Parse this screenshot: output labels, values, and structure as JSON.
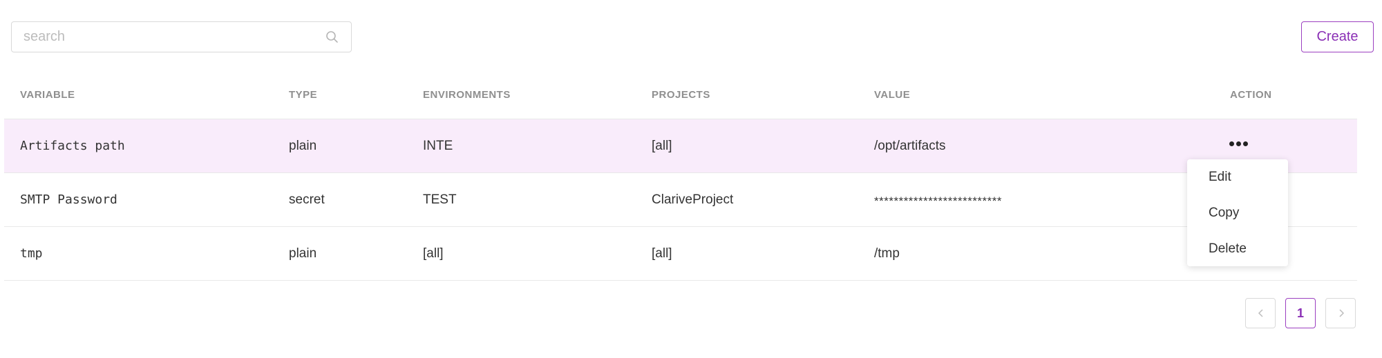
{
  "toolbar": {
    "search_placeholder": "search",
    "search_value": "",
    "search_icon": "search-icon",
    "create_label": "Create"
  },
  "table": {
    "columns": [
      "VARIABLE",
      "TYPE",
      "ENVIRONMENTS",
      "PROJECTS",
      "VALUE",
      "ACTION"
    ],
    "rows": [
      {
        "variable": "Artifacts path",
        "type": "plain",
        "environments": "INTE",
        "projects": "[all]",
        "value": "/opt/artifacts",
        "action_icon": "more-icon",
        "highlighted": true
      },
      {
        "variable": "SMTP Password",
        "type": "secret",
        "environments": "TEST",
        "projects": "ClariveProject",
        "value": "**************************",
        "action_icon": "more-icon",
        "highlighted": false
      },
      {
        "variable": "tmp",
        "type": "plain",
        "environments": "[all]",
        "projects": "[all]",
        "value": "/tmp",
        "action_icon": "more-icon",
        "highlighted": false
      }
    ]
  },
  "action_menu": {
    "items": [
      "Edit",
      "Copy",
      "Delete"
    ]
  },
  "pagination": {
    "prev_icon": "chevron-left-icon",
    "current_page": "1",
    "next_icon": "chevron-right-icon"
  },
  "colors": {
    "accent": "#9b3fc0",
    "row_highlight": "#f9ecfb",
    "header_text": "#8f8f8f",
    "border": "#e8e8e8"
  }
}
